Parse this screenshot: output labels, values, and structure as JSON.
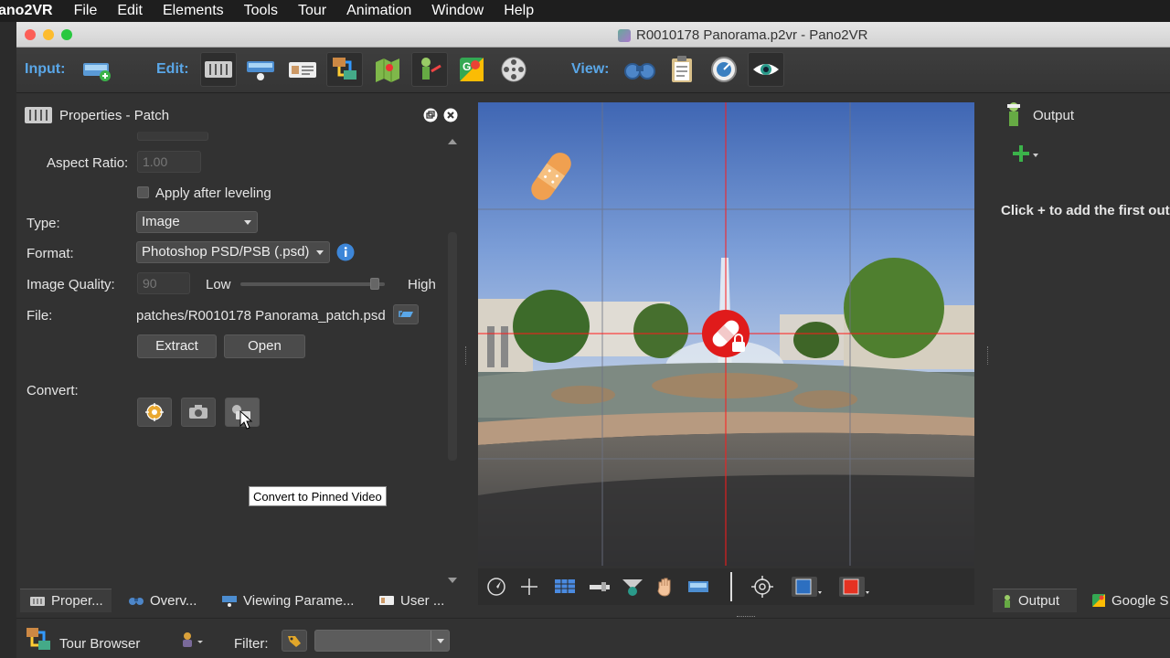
{
  "menubar": {
    "app_name": "ano2VR",
    "items": [
      "File",
      "Edit",
      "Elements",
      "Tools",
      "Tour",
      "Animation",
      "Window",
      "Help"
    ]
  },
  "window": {
    "title": "R0010178 Panorama.p2vr - Pano2VR"
  },
  "toolbar": {
    "input_label": "Input:",
    "edit_label": "Edit:",
    "view_label": "View:"
  },
  "properties": {
    "title": "Properties - Patch",
    "aspect_ratio_label": "Aspect Ratio:",
    "aspect_ratio_value": "1.00",
    "apply_after_leveling_label": "Apply after leveling",
    "type_label": "Type:",
    "type_value": "Image",
    "format_label": "Format:",
    "format_value": "Photoshop PSD/PSB (.psd)",
    "image_quality_label": "Image Quality:",
    "image_quality_value": "90",
    "quality_low": "Low",
    "quality_high": "High",
    "quality_level": 0.96,
    "file_label": "File:",
    "file_value": "patches/R0010178 Panorama_patch.psd",
    "extract_label": "Extract",
    "open_label": "Open",
    "convert_label": "Convert:",
    "tooltip": "Convert to Pinned Video"
  },
  "output": {
    "title": "Output",
    "empty_message": "Click + to add the first out"
  },
  "bottom_tabs": {
    "left": [
      "Proper...",
      "Overv...",
      "Viewing Parame...",
      "User ..."
    ],
    "right": [
      "Output",
      "Google S"
    ]
  },
  "tour_browser": {
    "title": "Tour Browser",
    "filter_label": "Filter:"
  },
  "colors": {
    "accent_blue": "#5aa7e8",
    "patch_red": "#e01b1b",
    "patch_orange": "#f0a050"
  }
}
